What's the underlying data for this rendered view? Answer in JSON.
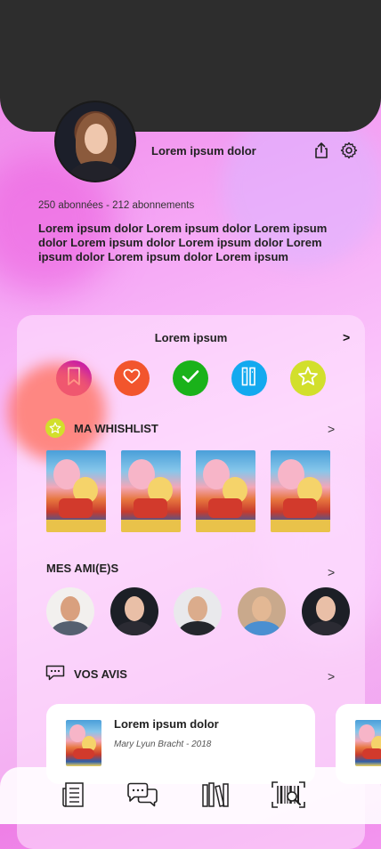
{
  "profile": {
    "username": "Lorem ipsum dolor",
    "stats": "250 abonnées - 212 abonnements",
    "bio": "Lorem ipsum dolor Lorem ipsum dolor Lorem ipsum dolor Lorem ipsum dolor Lorem ipsum dolor Lorem ipsum dolor Lorem ipsum dolor Lorem ipsum"
  },
  "library": {
    "title": "Lorem ipsum",
    "chevron": ">",
    "categories": [
      {
        "icon": "bookmark-icon",
        "color": "#c214b0"
      },
      {
        "icon": "heart-icon",
        "color": "#f2552d"
      },
      {
        "icon": "check-icon",
        "color": "#1ab21a"
      },
      {
        "icon": "books-icon",
        "color": "#13a9ef"
      },
      {
        "icon": "star-icon",
        "color": "#d2df2c"
      }
    ]
  },
  "wishlist": {
    "title": "MA WHISHLIST",
    "chevron": ">",
    "count": 4
  },
  "friends": {
    "title": "MES AMI(E)S",
    "chevron": ">",
    "count": 5
  },
  "reviews": {
    "title": "VOS AVIS",
    "chevron": ">",
    "items": [
      {
        "title": "Lorem ipsum dolor",
        "author": "Mary Lyun Bracht - 2018"
      }
    ]
  },
  "nav": {
    "items": [
      "newspaper-icon",
      "chat-icon",
      "library-icon",
      "barcode-scan-icon"
    ]
  },
  "colors": {
    "topbar": "#2d2d2d",
    "accent_star": "#d2df2c"
  }
}
